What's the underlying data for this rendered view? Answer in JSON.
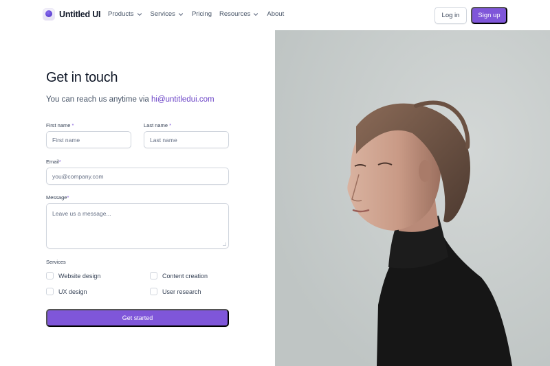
{
  "brand": {
    "name": "Untitled UI"
  },
  "nav": {
    "items": [
      {
        "label": "Products",
        "has_dropdown": true
      },
      {
        "label": "Services",
        "has_dropdown": true
      },
      {
        "label": "Pricing",
        "has_dropdown": false
      },
      {
        "label": "Resources",
        "has_dropdown": true
      },
      {
        "label": "About",
        "has_dropdown": false
      }
    ]
  },
  "header": {
    "login_label": "Log in",
    "signup_label": "Sign up"
  },
  "form": {
    "title": "Get in touch",
    "subtitle_prefix": "You can reach us anytime via ",
    "email_link": "hi@untitledui.com",
    "first_name": {
      "label": "First name",
      "placeholder": "First name",
      "required_mark": "*"
    },
    "last_name": {
      "label": "Last name",
      "placeholder": "Last name",
      "required_mark": "*"
    },
    "email": {
      "label": "Email",
      "placeholder": "you@company.com",
      "required_mark": "*"
    },
    "message": {
      "label": "Message",
      "placeholder": "Leave us a message...",
      "required_mark": "*"
    },
    "services_label": "Services",
    "services": [
      {
        "label": "Website design",
        "checked": false
      },
      {
        "label": "Content creation",
        "checked": false
      },
      {
        "label": "UX design",
        "checked": false
      },
      {
        "label": "User research",
        "checked": false
      }
    ],
    "submit_label": "Get started"
  },
  "colors": {
    "accent": "#7f56d9",
    "link": "#6941c6",
    "border": "#d0d5dd",
    "text_primary": "#101828",
    "text_secondary": "#475467"
  },
  "icons": [
    "logo-mark-icon",
    "chevron-down-icon"
  ]
}
